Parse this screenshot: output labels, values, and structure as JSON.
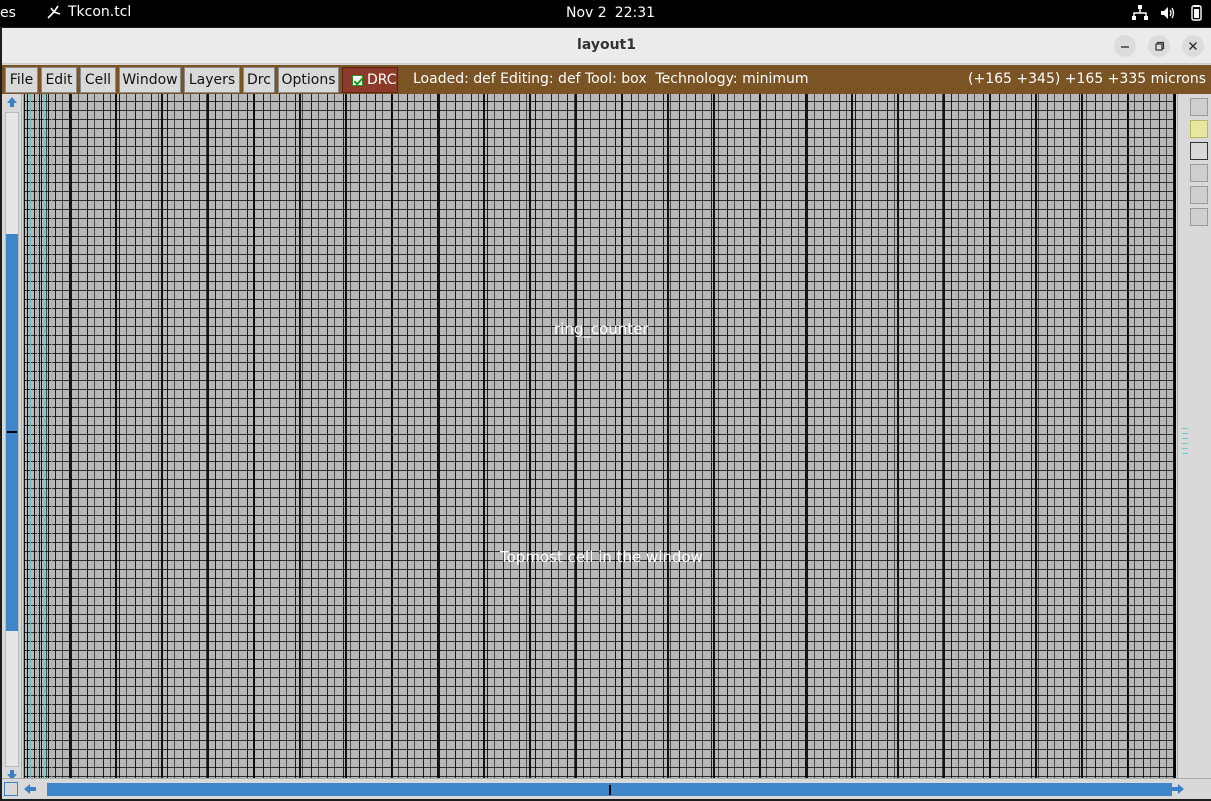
{
  "system_bar": {
    "activities": "es",
    "app_name": "Tkcon.tcl",
    "date": "Nov 2",
    "time": "22:31",
    "tray_icons": [
      "network-icon",
      "volume-icon",
      "battery-icon"
    ]
  },
  "window": {
    "title": "layout1",
    "controls": [
      "minimize",
      "maximize",
      "close"
    ]
  },
  "menubar": {
    "items": [
      "File",
      "Edit",
      "Cell",
      "Window",
      "Layers",
      "Drc",
      "Options"
    ],
    "drc_toggle": {
      "label": "DRC",
      "checked": true
    },
    "status": "Loaded: def Editing: def Tool: box  Technology: minimum",
    "coordinates": "(+165 +345) +165 +335 microns",
    "background_color": "#7b5426",
    "drc_color": "#8e3a2a"
  },
  "canvas": {
    "cell_label": "ring_counter",
    "topmost_label": "Topmost cell in the window",
    "background_color": "#b8b8b8",
    "accent_color": "#6fc7cf"
  },
  "scrollbars": {
    "thumb_color": "#3e86c7"
  }
}
